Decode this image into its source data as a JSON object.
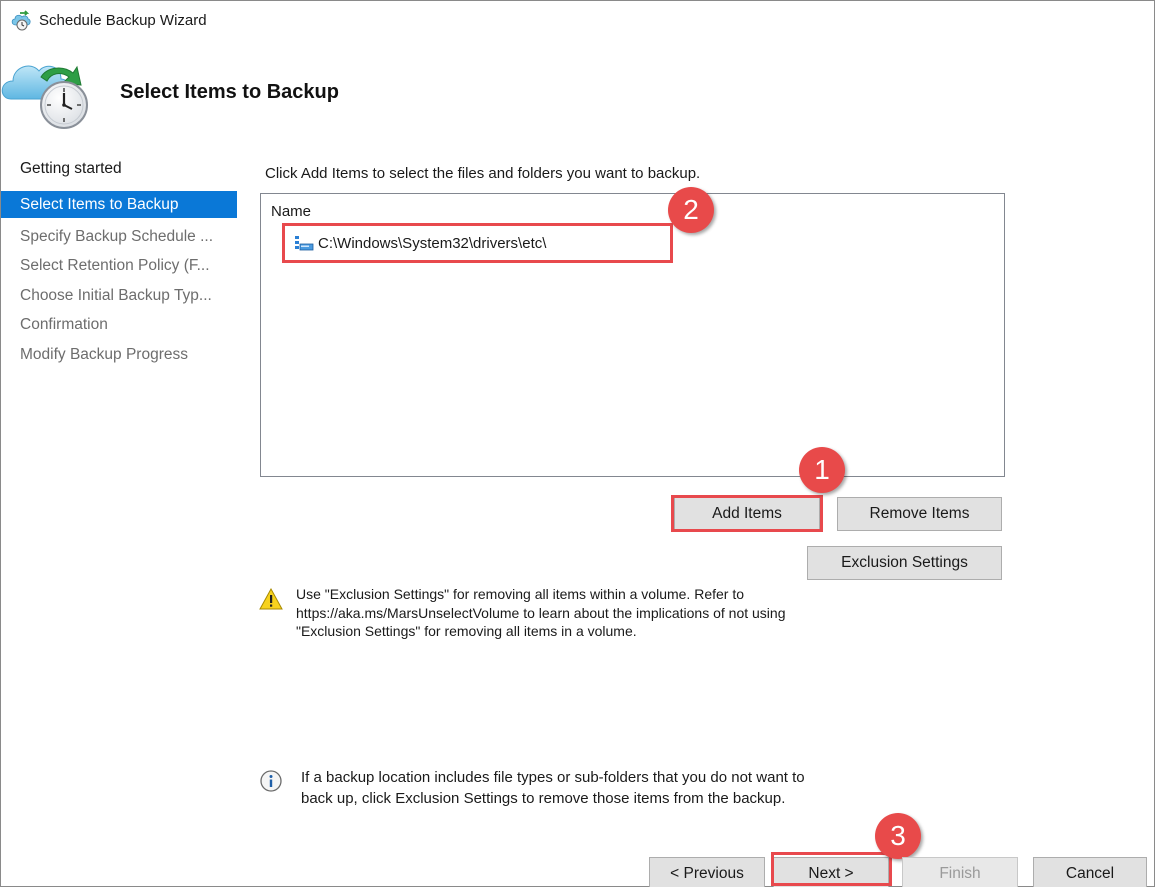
{
  "window": {
    "title": "Schedule Backup Wizard",
    "icon": "backup-wizard-icon"
  },
  "header": {
    "title": "Select Items to Backup",
    "icon": "cloud-clock-icon"
  },
  "nav": {
    "items": [
      {
        "label": "Getting started",
        "state": "done"
      },
      {
        "label": "Select Items to Backup",
        "state": "active"
      },
      {
        "label": "Specify Backup Schedule ...",
        "state": "pending"
      },
      {
        "label": "Select Retention Policy (F...",
        "state": "pending"
      },
      {
        "label": "Choose Initial Backup Typ...",
        "state": "pending"
      },
      {
        "label": "Confirmation",
        "state": "pending"
      },
      {
        "label": "Modify Backup Progress",
        "state": "pending"
      }
    ]
  },
  "main": {
    "instruction": "Click Add Items to select the files and folders you want to backup.",
    "list": {
      "column_header": "Name",
      "items": [
        {
          "path": "C:\\Windows\\System32\\drivers\\etc\\",
          "icon": "folder-tree-icon"
        }
      ]
    },
    "buttons": {
      "add_items": "Add Items",
      "remove_items": "Remove Items",
      "exclusion_settings": "Exclusion Settings"
    },
    "warning": {
      "icon": "warning-icon",
      "line1": "Use \"Exclusion Settings\" for removing all items within a volume. Refer to",
      "line2": "https://aka.ms/MarsUnselectVolume to learn about the implications of not using",
      "line3": "\"Exclusion Settings\" for removing all items in a volume."
    },
    "info": {
      "icon": "info-icon",
      "line1": "If a backup location includes file types or sub-folders that you do not want to",
      "line2": "back up, click Exclusion Settings to remove those items from the backup."
    }
  },
  "footer": {
    "previous": "< Previous",
    "next": "Next >",
    "finish": "Finish",
    "cancel": "Cancel"
  },
  "annotations": {
    "step1": "1",
    "step2": "2",
    "step3": "3",
    "color": "#e84a4a"
  },
  "colors": {
    "active_nav": "#0a78d7",
    "highlight": "#e8494d"
  }
}
